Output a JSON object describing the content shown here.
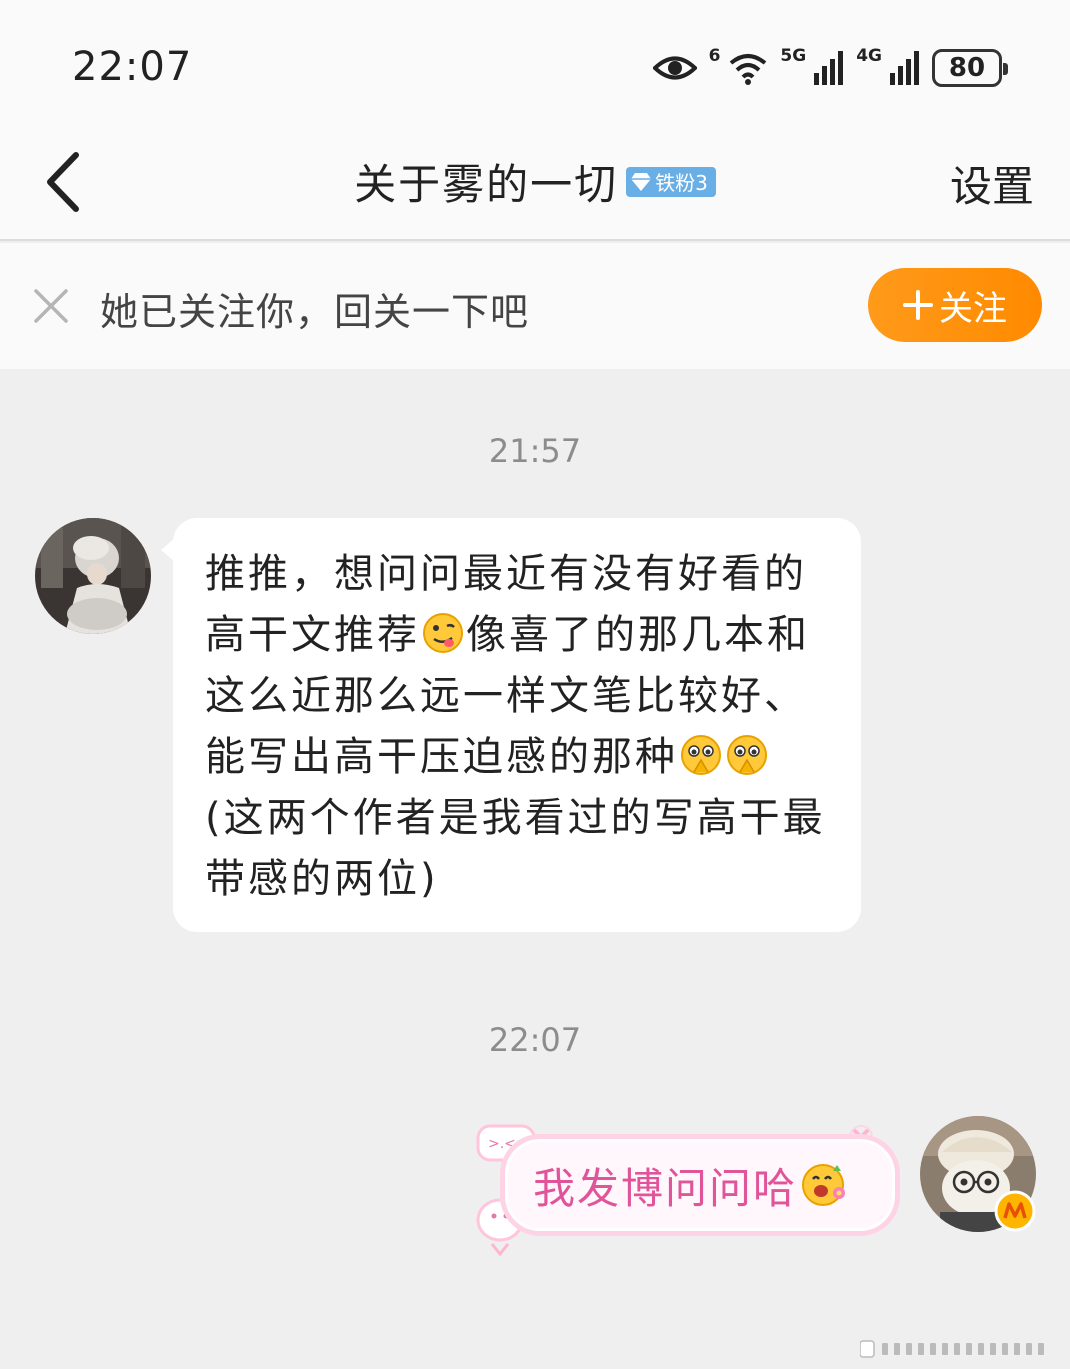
{
  "status_bar": {
    "time": "22:07",
    "wifi_label": "6",
    "sim1_label": "5G",
    "sim2_label": "4G",
    "battery": "80"
  },
  "header": {
    "title": "关于雾的一切",
    "badge": "铁粉3",
    "settings_label": "设置"
  },
  "follow_bar": {
    "text": "她已关注你，回关一下吧",
    "button_label": "关注"
  },
  "messages": [
    {
      "time": "21:57",
      "side": "left",
      "parts": [
        "推推，想问问最近有没有好看的高干文推荐",
        "像喜了的那几本和这么近那么远一样文笔比较好、能写出高干压迫感的那种",
        "(这两个作者是我看过的写高干最带感的两位)"
      ]
    },
    {
      "time": "22:07",
      "side": "right",
      "text": "我发博问问哈"
    }
  ],
  "colors": {
    "accent_orange": "#ff8a00",
    "badge_blue": "#6aaee6",
    "pink_text": "#e0559a"
  }
}
